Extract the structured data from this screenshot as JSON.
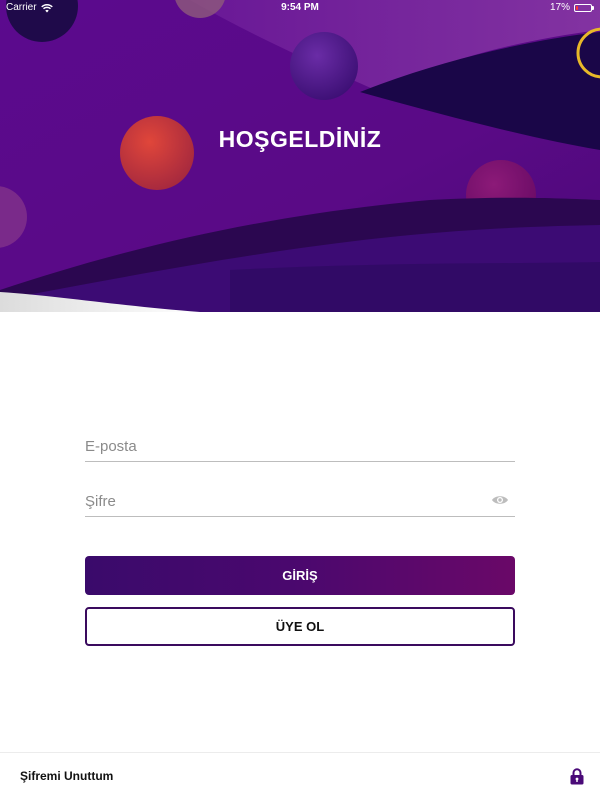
{
  "status_bar": {
    "carrier": "Carrier",
    "time": "9:54 PM",
    "battery": "17%",
    "battery_level": 0.17,
    "icons": [
      "wifi-icon",
      "battery-icon"
    ]
  },
  "hero": {
    "title": "HOŞGELDİNİZ"
  },
  "form": {
    "email_placeholder": "E-posta",
    "email_value": "",
    "password_placeholder": "Şifre",
    "password_value": "",
    "password_toggle_icon": "eye-icon"
  },
  "buttons": {
    "login_label": "GİRİŞ",
    "signup_label": "ÜYE OL"
  },
  "footer": {
    "forgot_password_label": "Şifremi Unuttum",
    "lock_icon": "lock-icon"
  },
  "colors": {
    "primary_purple": "#3a0a6b",
    "accent_magenta": "#6a0868",
    "hero_dark": "#2a0352",
    "ring_yellow": "#e8b829"
  }
}
